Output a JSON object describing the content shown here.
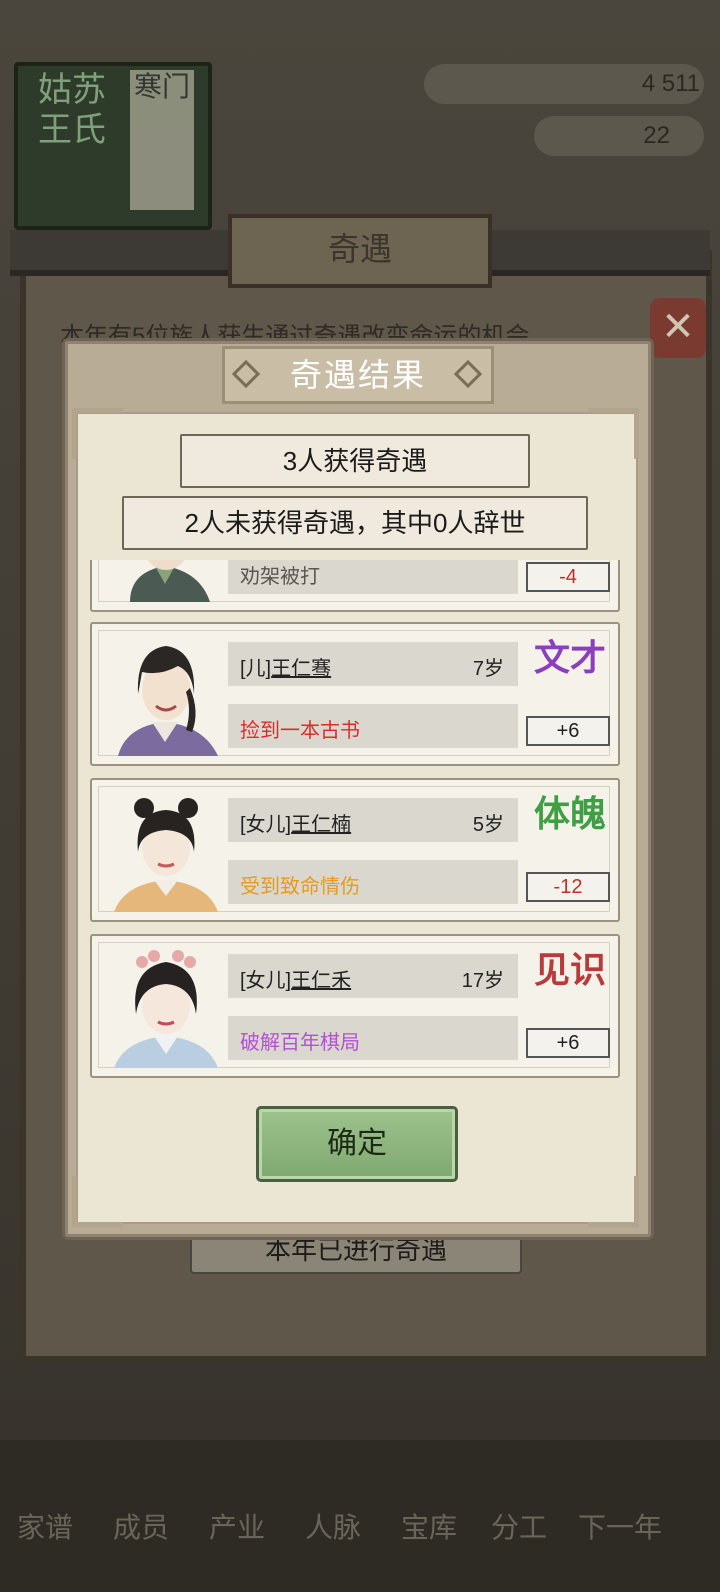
{
  "background": {
    "family_book": {
      "title": "姑苏 王氏",
      "subtitle": "寒门"
    },
    "currency": {
      "value": "4 511"
    },
    "gold": {
      "value": "22"
    },
    "panel_title": "奇遇",
    "panel_description": "本年有5位族人获生通过奇遇改变命运的机会",
    "done_label": "本年已进行奇遇",
    "close_icon": "close-icon",
    "nav": [
      "家谱",
      "成员",
      "产业",
      "人脉",
      "宝库",
      "分工",
      "下一年"
    ]
  },
  "modal": {
    "title": "奇遇结果",
    "gained_summary": "3人获得奇遇",
    "not_gained_summary": "2人未获得奇遇，其中0人辞世",
    "confirm_label": "确定",
    "cards": [
      {
        "relation": "",
        "name": "",
        "age": "",
        "event": "劝架被打",
        "event_color": "#333333",
        "attr": "",
        "attr_color": "#8a3030",
        "delta": "-4",
        "delta_color": "#c0302a"
      },
      {
        "relation": "[儿]",
        "name": "王仁骞",
        "age": "7岁",
        "event": "捡到一本古书",
        "event_color": "#d92c2c",
        "attr": "文才",
        "attr_color": "#8a3fbf",
        "delta": "+6",
        "delta_color": "#222222"
      },
      {
        "relation": "[女儿]",
        "name": "王仁楠",
        "age": "5岁",
        "event": "受到致命情伤",
        "event_color": "#e89a1c",
        "attr": "体魄",
        "attr_color": "#3f9f45",
        "delta": "-12",
        "delta_color": "#c0302a"
      },
      {
        "relation": "[女儿]",
        "name": "王仁禾",
        "age": "17岁",
        "event": "破解百年棋局",
        "event_color": "#b44fd8",
        "attr": "见识",
        "attr_color": "#b83a3a",
        "delta": "+6",
        "delta_color": "#222222"
      }
    ]
  }
}
